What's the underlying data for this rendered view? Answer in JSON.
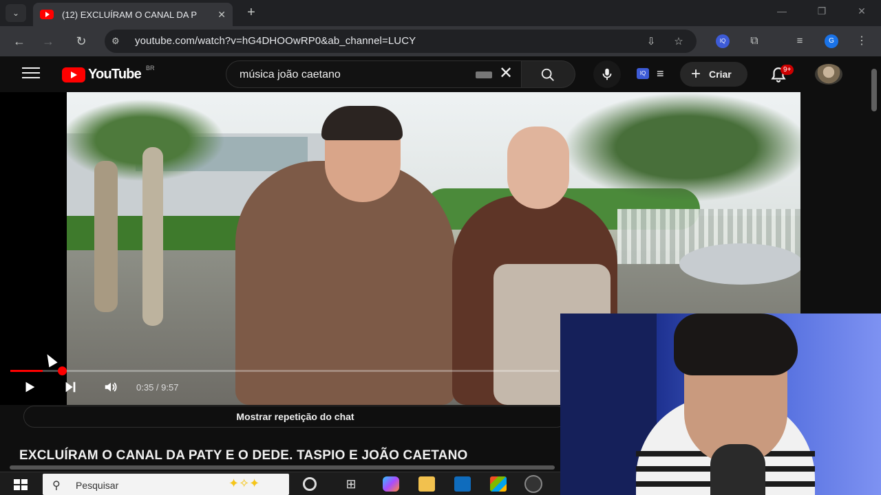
{
  "browser": {
    "tab_title": "(12) EXCLUÍRAM O CANAL DA P",
    "url": "youtube.com/watch?v=hG4DHOOwRP0&ab_channel=LUCY",
    "profile_initial": "G"
  },
  "youtube": {
    "wordmark": "YouTube",
    "country_code": "BR",
    "search_query": "música joão caetano",
    "create_label": "Criar",
    "notification_badge": "9+",
    "extension_badge": "IQ"
  },
  "player": {
    "time": "0:35 / 9:57",
    "progress_fraction": 0.0585
  },
  "chat_replay_label": "Mostrar repetição do chat",
  "video_title": "EXCLUÍRAM O CANAL DA PATY E O DEDE. TASPIO E JOÃO CAETANO",
  "taskbar": {
    "search_placeholder": "Pesquisar"
  },
  "colors": {
    "youtube_red": "#ff0000",
    "page_bg": "#0f0f0f",
    "progress": "#ff0000"
  }
}
